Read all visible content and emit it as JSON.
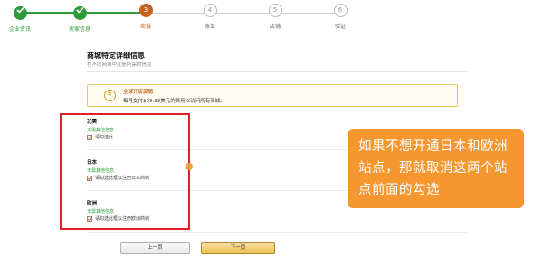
{
  "stepper": {
    "steps": [
      {
        "number": "",
        "label": "企业资讯",
        "state": "done"
      },
      {
        "number": "",
        "label": "卖家信息",
        "state": "done"
      },
      {
        "number": "3",
        "label": "商城",
        "state": "current"
      },
      {
        "number": "4",
        "label": "账单",
        "state": "todo"
      },
      {
        "number": "5",
        "label": "店铺",
        "state": "todo"
      },
      {
        "number": "6",
        "label": "验证",
        "state": "todo"
      }
    ]
  },
  "main": {
    "title": "商城特定详细信息",
    "subtitle": "在不同商城中注册所需的信息",
    "promo": {
      "title": "全球开店促销",
      "text": "每月支付$39.99美元的费用以访问所有商城。"
    },
    "markets": [
      {
        "name": "北美",
        "note": "无需其他信息",
        "checkbox_label": "请勾选此"
      },
      {
        "name": "日本",
        "note": "无需其他信息",
        "checkbox_label": "请勾选此框以注册日本商城"
      },
      {
        "name": "欧洲",
        "note": "无需其他信息",
        "checkbox_label": "请勾选此框以注册欧洲商城"
      }
    ]
  },
  "callout": {
    "text": "如果不想开通日本和欧洲站点，那就取消这两个站点前面的勾选"
  },
  "buttons": {
    "prev_label": "上一页",
    "next_label": "下一页"
  },
  "colors": {
    "done": "#2e9b3a",
    "current": "#c75f1e",
    "highlight": "#e0202a",
    "callout": "#f5962f"
  }
}
